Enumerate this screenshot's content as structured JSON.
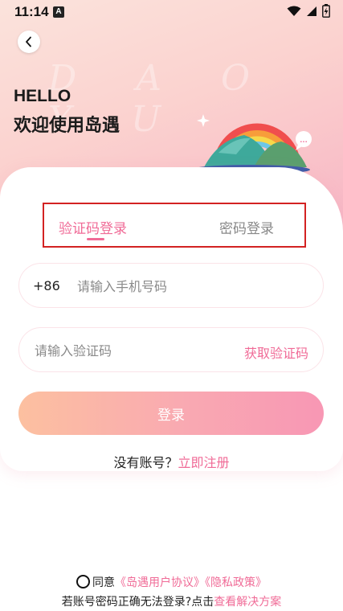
{
  "status_bar": {
    "time": "11:14",
    "notification_icon": "A"
  },
  "hero": {
    "watermark": "D A O Y U",
    "greeting": "HELLO",
    "welcome": "欢迎使用岛遇"
  },
  "tabs": {
    "sms_login": "验证码登录",
    "password_login": "密码登录"
  },
  "form": {
    "country_code": "+86",
    "phone_placeholder": "请输入手机号码",
    "code_placeholder": "请输入验证码",
    "get_code": "获取验证码",
    "login": "登录"
  },
  "register": {
    "prompt": "没有账号？",
    "link": "立即注册"
  },
  "footer": {
    "agree": "同意",
    "user_agreement": "《岛遇用户协议》",
    "privacy_policy": "《隐私政策》",
    "trouble_text": "若账号密码正确无法登录?点击",
    "trouble_link": "查看解决方案"
  },
  "colors": {
    "accent": "#f06b97",
    "button_start": "#fcc0a0",
    "button_end": "#f897b4"
  },
  "icons": [
    "back-icon",
    "wifi-icon",
    "signal-icon",
    "battery-icon",
    "sparkle-icon",
    "chat-bubble-icon"
  ]
}
